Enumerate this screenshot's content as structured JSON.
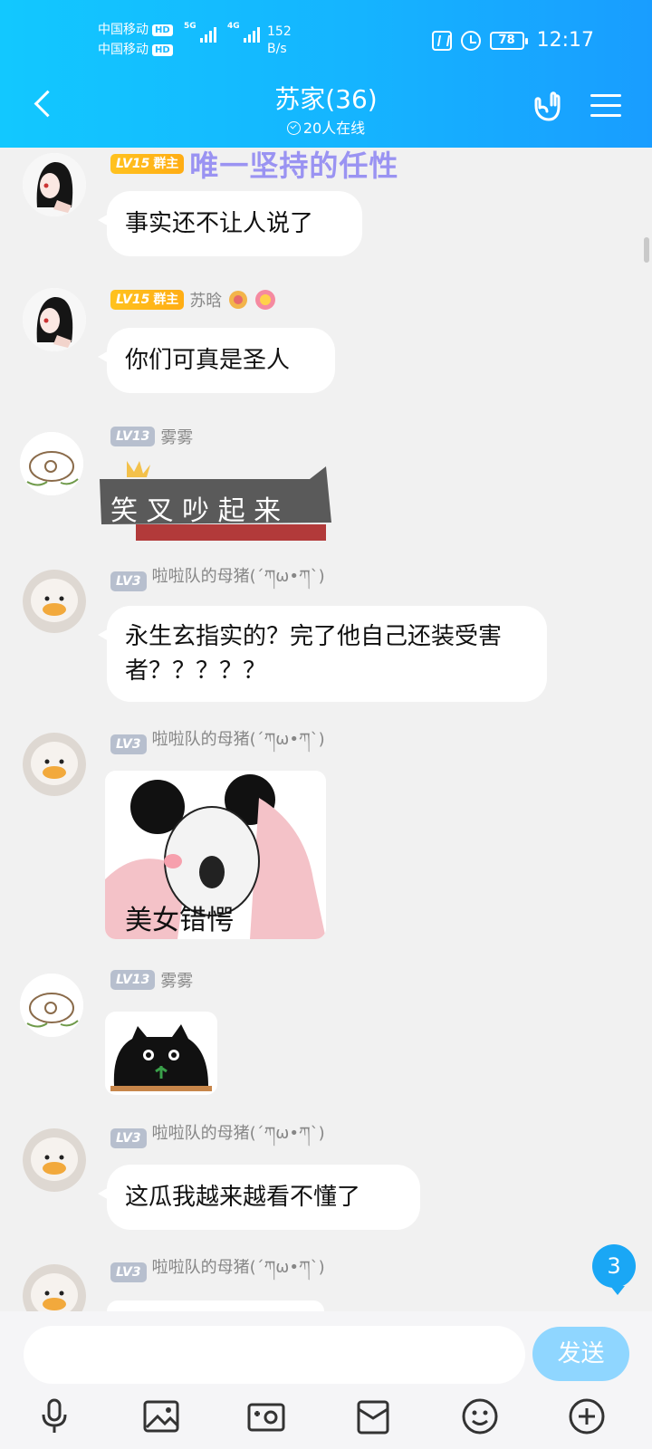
{
  "status_bar": {
    "carrier1": "中国移动",
    "carrier2": "中国移动",
    "hd": "HD",
    "net1": "5G",
    "net2": "4G",
    "speed_value": "152",
    "speed_unit": "B/s",
    "battery": "78",
    "time": "12:17"
  },
  "header": {
    "title": "苏家(36)",
    "online": "20人在线"
  },
  "messages": [
    {
      "level": "LV15",
      "role": "群主",
      "nick": "唯一坚持的任性",
      "text": "事实还不让人说了"
    },
    {
      "level": "LV15",
      "role": "群主",
      "nick": "苏晗",
      "text": "你们可真是圣人"
    },
    {
      "level": "LV13",
      "nick": "雾雾",
      "sticker_text": "笑 叉 吵 起 来"
    },
    {
      "level": "LV3",
      "nick": "啦啦队的母猪(´ཀω•ཀ`)",
      "text": "永生玄指实的？完了他自己还装受害者？？？？？"
    },
    {
      "level": "LV3",
      "nick": "啦啦队的母猪(´ཀω•ཀ`)",
      "sticker_text": "美女错愕"
    },
    {
      "level": "LV13",
      "nick": "雾雾"
    },
    {
      "level": "LV3",
      "nick": "啦啦队的母猪(´ཀω•ཀ`)",
      "text": "这瓜我越来越看不懂了"
    },
    {
      "level": "LV3",
      "nick": "啦啦队的母猪(´ཀω•ཀ`)"
    }
  ],
  "unread_count": "3",
  "input": {
    "placeholder": "",
    "send_label": "发送"
  },
  "icons": [
    "back-icon",
    "hand-icon",
    "menu-icon",
    "mic-icon",
    "image-icon",
    "camera-icon",
    "gift-icon",
    "emoji-icon",
    "plus-icon"
  ],
  "colors": {
    "header": "#15b4ff",
    "send": "#8fd6ff",
    "unread": "#1aa7f5",
    "level_gold": "#ffb81a",
    "level_gray": "#b7bfce"
  }
}
